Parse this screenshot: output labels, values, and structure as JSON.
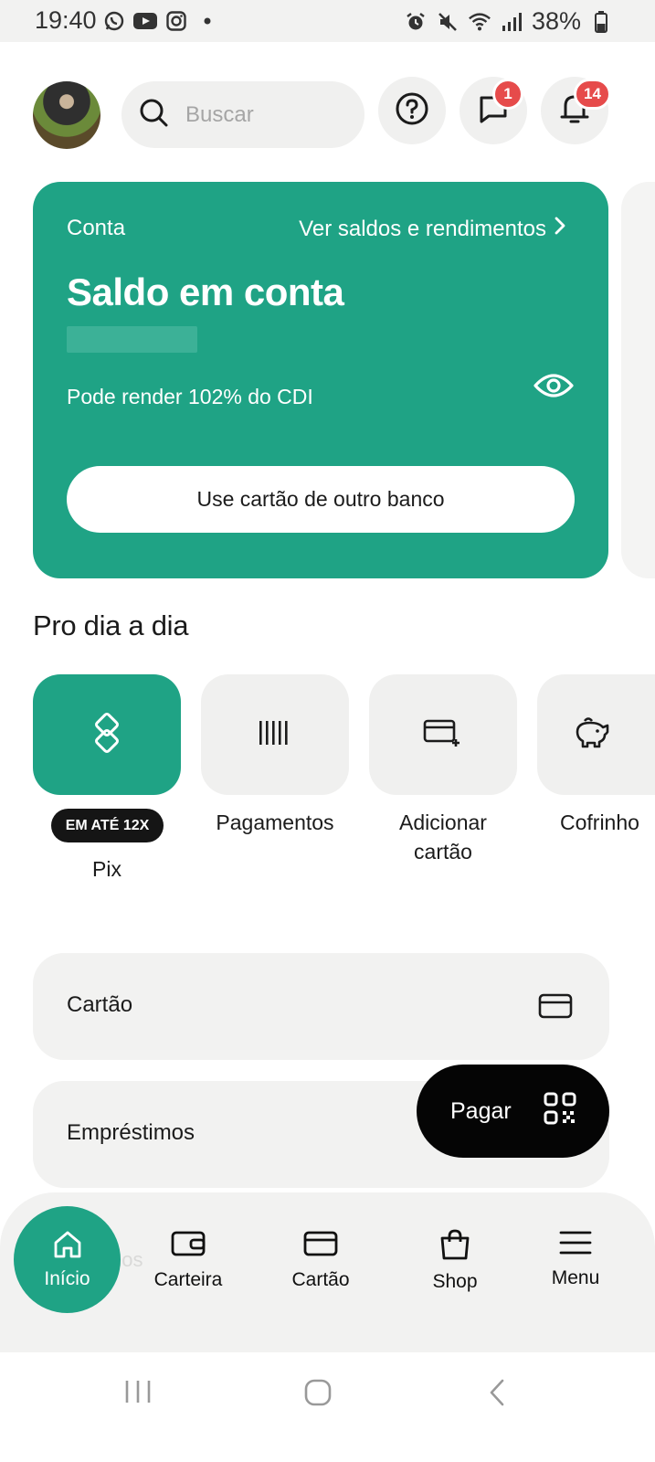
{
  "status_bar": {
    "time": "19:40",
    "left_icons": [
      "whatsapp-icon",
      "youtube-icon",
      "instagram-icon",
      "dot-icon"
    ],
    "right_icons": [
      "alarm-icon",
      "mute-icon",
      "wifi-icon",
      "signal-icon"
    ],
    "battery": "38%"
  },
  "header": {
    "search_placeholder": "Buscar",
    "messages_badge": "1",
    "notifications_badge": "14"
  },
  "account_card": {
    "label": "Conta",
    "link": "Ver saldos e rendimentos",
    "title": "Saldo em conta",
    "yield_text": "Pode render 102% do CDI",
    "button_label": "Use cartão de outro banco"
  },
  "daily": {
    "title": "Pro dia a dia",
    "pix_badge": "EM ATÉ 12X",
    "items": [
      {
        "label": "Pix",
        "icon": "pix-icon"
      },
      {
        "label": "Pagamentos",
        "icon": "barcode-icon"
      },
      {
        "label": "Adicionar\ncartão",
        "icon": "add-card-icon"
      },
      {
        "label": "Cofrinho",
        "icon": "piggy-bank-icon"
      }
    ]
  },
  "rows": [
    {
      "label": "Cartão",
      "icon": "card-icon"
    },
    {
      "label": "Empréstimos"
    }
  ],
  "pay_button": {
    "label": "Pagar",
    "icon": "qr-code-icon"
  },
  "ghost_text": "hos",
  "bottom_nav": [
    {
      "label": "Início",
      "icon": "home-icon"
    },
    {
      "label": "Carteira",
      "icon": "wallet-icon"
    },
    {
      "label": "Cartão",
      "icon": "card-icon"
    },
    {
      "label": "Shop",
      "icon": "shopping-bag-icon"
    },
    {
      "label": "Menu",
      "icon": "menu-icon"
    }
  ],
  "colors": {
    "brand_green": "#1fa385",
    "badge_red": "#e64b4b"
  }
}
